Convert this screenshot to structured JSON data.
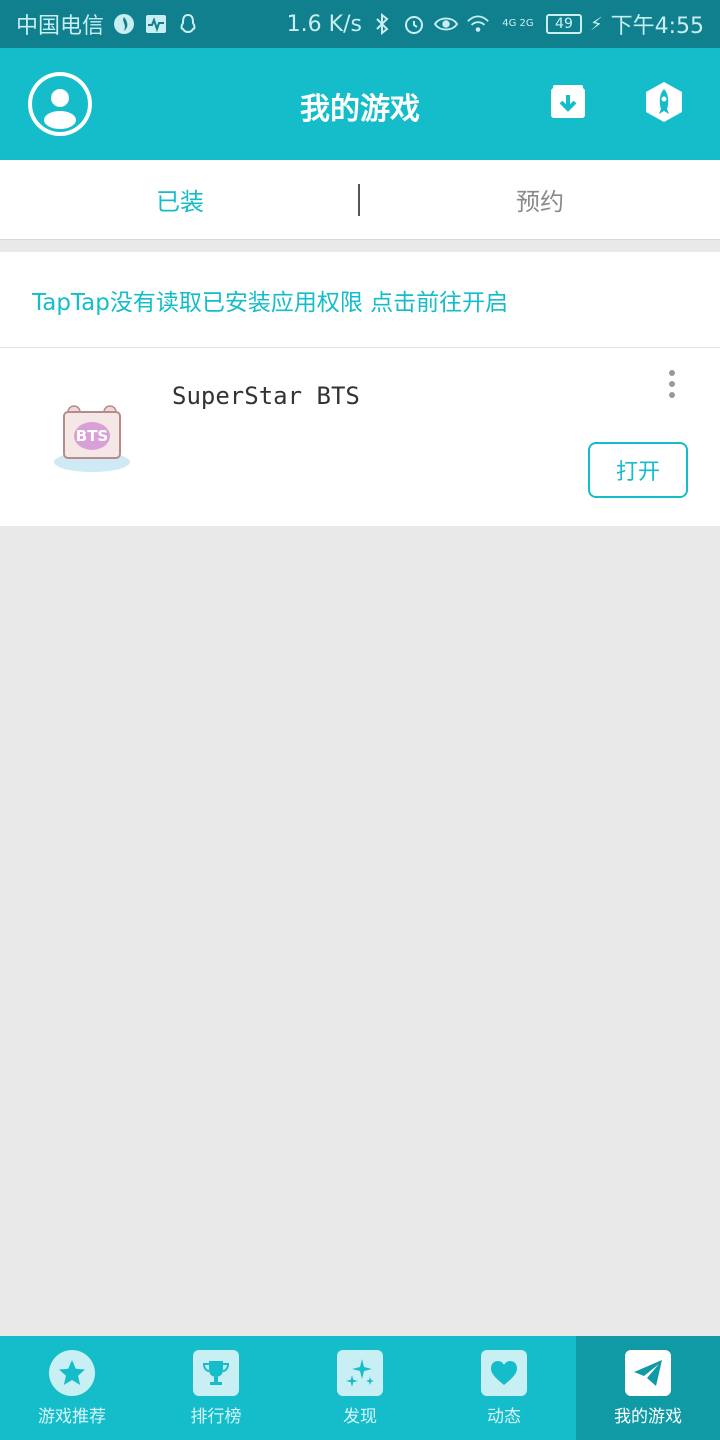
{
  "status_bar": {
    "carrier": "中国电信",
    "speed": "1.6 K/s",
    "network": "4G 2G",
    "battery": "49",
    "time": "下午4:55"
  },
  "header": {
    "title": "我的游戏"
  },
  "tabs": [
    {
      "label": "已装",
      "active": true
    },
    {
      "label": "预约",
      "active": false
    }
  ],
  "permission_notice": "TapTap没有读取已安装应用权限 点击前往开启",
  "games": [
    {
      "name": "SuperStar BTS",
      "action": "打开",
      "icon_text": "BTS"
    }
  ],
  "bottom_nav": [
    {
      "label": "游戏推荐",
      "icon": "star-icon",
      "active": false
    },
    {
      "label": "排行榜",
      "icon": "trophy-icon",
      "active": false
    },
    {
      "label": "发现",
      "icon": "sparkle-icon",
      "active": false
    },
    {
      "label": "动态",
      "icon": "heart-icon",
      "active": false
    },
    {
      "label": "我的游戏",
      "icon": "paper-plane-icon",
      "active": true
    }
  ],
  "colors": {
    "accent": "#14bdc9",
    "status_bar": "#10808e",
    "nav_active": "#0f9aa6",
    "background": "#e9e9e9"
  }
}
